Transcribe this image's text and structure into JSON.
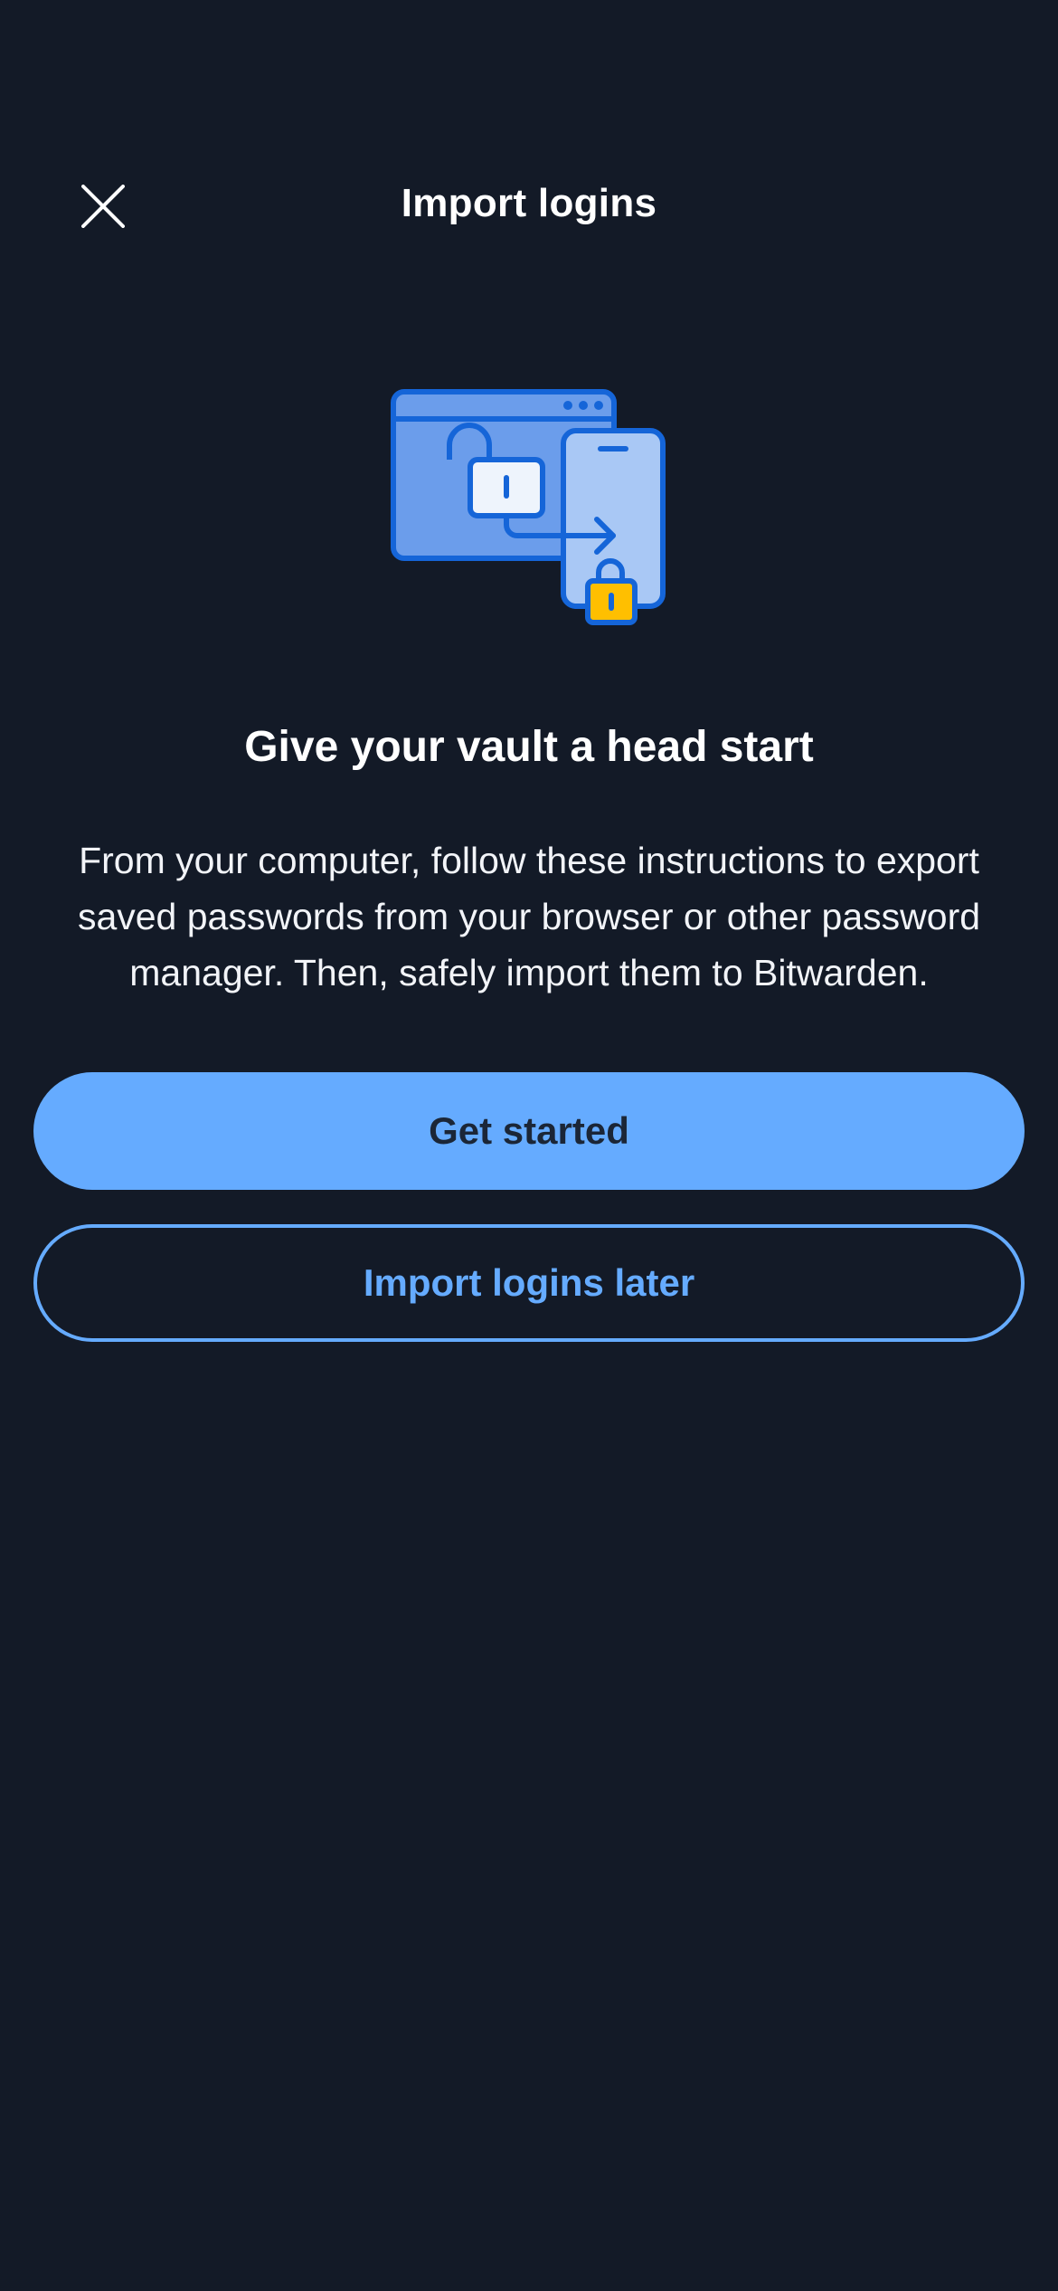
{
  "header": {
    "title": "Import logins",
    "close_icon": "close-icon"
  },
  "illustration": {
    "icon": "browser-to-phone-import-illustration",
    "colors": {
      "primary": "#1565D8",
      "fill_light": "#A9C8F5",
      "fill_mid": "#6B9DEB",
      "lock_accent": "#FFBF00"
    }
  },
  "main": {
    "headline": "Give your vault a head start",
    "description": "From your computer, follow these instructions to export saved passwords from your browser or other password manager. Then, safely import them to Bitwarden."
  },
  "actions": {
    "primary_label": "Get started",
    "secondary_label": "Import logins later"
  },
  "colors": {
    "background": "#131A27",
    "accent": "#65ABFF",
    "primary_button_text": "#1B2637"
  }
}
